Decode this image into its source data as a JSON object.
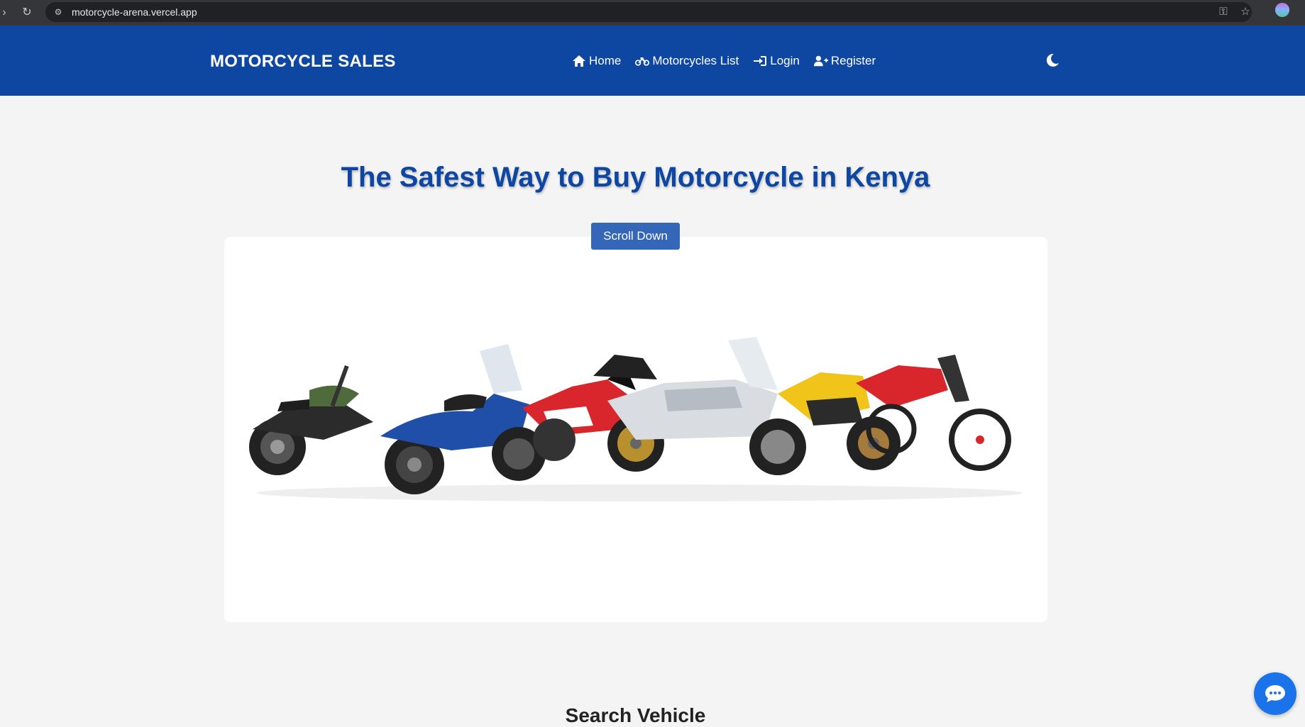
{
  "browser": {
    "url": "motorcycle-arena.vercel.app",
    "icons": [
      "back-icon",
      "reload-icon",
      "site-settings-icon",
      "password-key-icon",
      "bookmark-star-icon",
      "profile-avatar"
    ]
  },
  "header": {
    "brand": "MOTORCYCLE SALES",
    "nav": [
      {
        "label": "Home",
        "icon": "home-icon"
      },
      {
        "label": "Motorcycles List",
        "icon": "motorcycle-icon"
      },
      {
        "label": "Login",
        "icon": "login-icon"
      },
      {
        "label": "Register",
        "icon": "user-plus-icon"
      }
    ],
    "theme_toggle_icon": "moon-icon"
  },
  "hero": {
    "title": "The Safest Way to Buy Motorcycle in Kenya",
    "scroll_button": "Scroll Down",
    "image_subject": "lineup-of-motorcycles"
  },
  "search": {
    "title": "Search Vehicle"
  },
  "chat": {
    "icon": "chat-bubble-icon"
  },
  "colors": {
    "header_bg": "#0e47a1",
    "title": "#0e47a1",
    "button": "#3567b8",
    "chat": "#1a73e8",
    "page_bg": "#f4f4f4"
  }
}
